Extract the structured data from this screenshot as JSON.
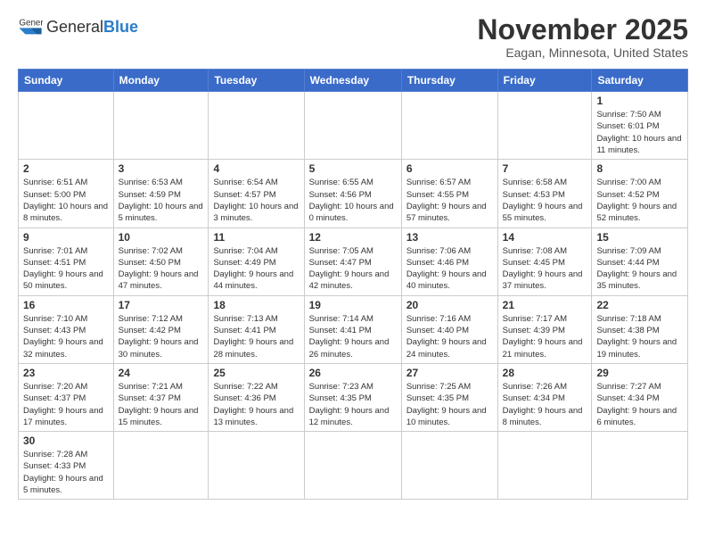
{
  "header": {
    "logo_general": "General",
    "logo_blue": "Blue",
    "month_title": "November 2025",
    "location": "Eagan, Minnesota, United States"
  },
  "weekdays": [
    "Sunday",
    "Monday",
    "Tuesday",
    "Wednesday",
    "Thursday",
    "Friday",
    "Saturday"
  ],
  "weeks": [
    [
      {
        "day": "",
        "info": ""
      },
      {
        "day": "",
        "info": ""
      },
      {
        "day": "",
        "info": ""
      },
      {
        "day": "",
        "info": ""
      },
      {
        "day": "",
        "info": ""
      },
      {
        "day": "",
        "info": ""
      },
      {
        "day": "1",
        "info": "Sunrise: 7:50 AM\nSunset: 6:01 PM\nDaylight: 10 hours and 11 minutes."
      }
    ],
    [
      {
        "day": "2",
        "info": "Sunrise: 6:51 AM\nSunset: 5:00 PM\nDaylight: 10 hours and 8 minutes."
      },
      {
        "day": "3",
        "info": "Sunrise: 6:53 AM\nSunset: 4:59 PM\nDaylight: 10 hours and 5 minutes."
      },
      {
        "day": "4",
        "info": "Sunrise: 6:54 AM\nSunset: 4:57 PM\nDaylight: 10 hours and 3 minutes."
      },
      {
        "day": "5",
        "info": "Sunrise: 6:55 AM\nSunset: 4:56 PM\nDaylight: 10 hours and 0 minutes."
      },
      {
        "day": "6",
        "info": "Sunrise: 6:57 AM\nSunset: 4:55 PM\nDaylight: 9 hours and 57 minutes."
      },
      {
        "day": "7",
        "info": "Sunrise: 6:58 AM\nSunset: 4:53 PM\nDaylight: 9 hours and 55 minutes."
      },
      {
        "day": "8",
        "info": "Sunrise: 7:00 AM\nSunset: 4:52 PM\nDaylight: 9 hours and 52 minutes."
      }
    ],
    [
      {
        "day": "9",
        "info": "Sunrise: 7:01 AM\nSunset: 4:51 PM\nDaylight: 9 hours and 50 minutes."
      },
      {
        "day": "10",
        "info": "Sunrise: 7:02 AM\nSunset: 4:50 PM\nDaylight: 9 hours and 47 minutes."
      },
      {
        "day": "11",
        "info": "Sunrise: 7:04 AM\nSunset: 4:49 PM\nDaylight: 9 hours and 44 minutes."
      },
      {
        "day": "12",
        "info": "Sunrise: 7:05 AM\nSunset: 4:47 PM\nDaylight: 9 hours and 42 minutes."
      },
      {
        "day": "13",
        "info": "Sunrise: 7:06 AM\nSunset: 4:46 PM\nDaylight: 9 hours and 40 minutes."
      },
      {
        "day": "14",
        "info": "Sunrise: 7:08 AM\nSunset: 4:45 PM\nDaylight: 9 hours and 37 minutes."
      },
      {
        "day": "15",
        "info": "Sunrise: 7:09 AM\nSunset: 4:44 PM\nDaylight: 9 hours and 35 minutes."
      }
    ],
    [
      {
        "day": "16",
        "info": "Sunrise: 7:10 AM\nSunset: 4:43 PM\nDaylight: 9 hours and 32 minutes."
      },
      {
        "day": "17",
        "info": "Sunrise: 7:12 AM\nSunset: 4:42 PM\nDaylight: 9 hours and 30 minutes."
      },
      {
        "day": "18",
        "info": "Sunrise: 7:13 AM\nSunset: 4:41 PM\nDaylight: 9 hours and 28 minutes."
      },
      {
        "day": "19",
        "info": "Sunrise: 7:14 AM\nSunset: 4:41 PM\nDaylight: 9 hours and 26 minutes."
      },
      {
        "day": "20",
        "info": "Sunrise: 7:16 AM\nSunset: 4:40 PM\nDaylight: 9 hours and 24 minutes."
      },
      {
        "day": "21",
        "info": "Sunrise: 7:17 AM\nSunset: 4:39 PM\nDaylight: 9 hours and 21 minutes."
      },
      {
        "day": "22",
        "info": "Sunrise: 7:18 AM\nSunset: 4:38 PM\nDaylight: 9 hours and 19 minutes."
      }
    ],
    [
      {
        "day": "23",
        "info": "Sunrise: 7:20 AM\nSunset: 4:37 PM\nDaylight: 9 hours and 17 minutes."
      },
      {
        "day": "24",
        "info": "Sunrise: 7:21 AM\nSunset: 4:37 PM\nDaylight: 9 hours and 15 minutes."
      },
      {
        "day": "25",
        "info": "Sunrise: 7:22 AM\nSunset: 4:36 PM\nDaylight: 9 hours and 13 minutes."
      },
      {
        "day": "26",
        "info": "Sunrise: 7:23 AM\nSunset: 4:35 PM\nDaylight: 9 hours and 12 minutes."
      },
      {
        "day": "27",
        "info": "Sunrise: 7:25 AM\nSunset: 4:35 PM\nDaylight: 9 hours and 10 minutes."
      },
      {
        "day": "28",
        "info": "Sunrise: 7:26 AM\nSunset: 4:34 PM\nDaylight: 9 hours and 8 minutes."
      },
      {
        "day": "29",
        "info": "Sunrise: 7:27 AM\nSunset: 4:34 PM\nDaylight: 9 hours and 6 minutes."
      }
    ],
    [
      {
        "day": "30",
        "info": "Sunrise: 7:28 AM\nSunset: 4:33 PM\nDaylight: 9 hours and 5 minutes."
      },
      {
        "day": "",
        "info": ""
      },
      {
        "day": "",
        "info": ""
      },
      {
        "day": "",
        "info": ""
      },
      {
        "day": "",
        "info": ""
      },
      {
        "day": "",
        "info": ""
      },
      {
        "day": "",
        "info": ""
      }
    ]
  ]
}
